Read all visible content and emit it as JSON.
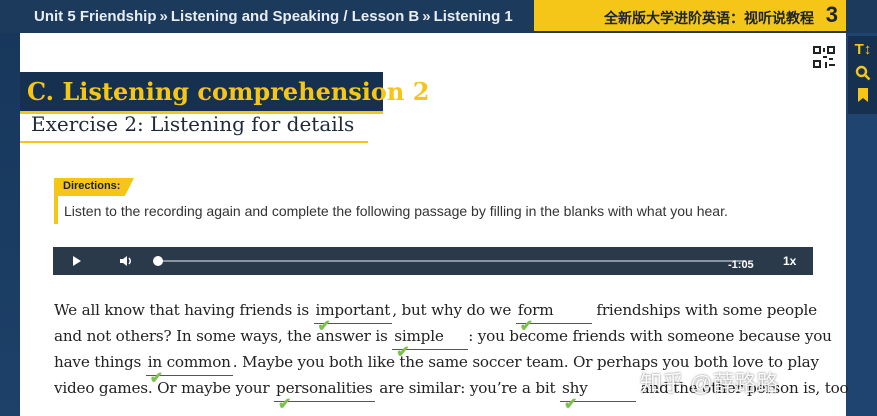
{
  "header": {
    "breadcrumb": [
      "Unit 5 Friendship",
      "Listening and Speaking / Lesson B",
      "Listening 1"
    ],
    "breadcrumb_separator": "»",
    "brand": "全新版大学进阶英语：视听说教程",
    "brand_number": "3",
    "accent_color": "#f5c518",
    "dark_color": "#16314f"
  },
  "section": {
    "title": "C. Listening comprehension 2"
  },
  "exercise": {
    "title": "Exercise 2: Listening for details",
    "directions_label": "Directions:",
    "directions_text": "Listen to the recording again and complete the following passage by filling in the blanks with what you hear."
  },
  "player": {
    "time": "-1:05",
    "speed": "1x",
    "progress": 0
  },
  "rail": {
    "icons": [
      "font-size-icon",
      "search-icon",
      "bookmark-icon"
    ],
    "font_icon_text": "T↕"
  },
  "passage": {
    "l1_a": "We all know that having friends is ",
    "l1_b1": "important",
    "l1_c": ", but why do we ",
    "l1_b2": "form",
    "l1_d": " friendships with some people",
    "l2_a": "and not others? In some ways, the answer is ",
    "l2_b1": "simple",
    "l2_c": ": you become friends with someone because you",
    "l3_a": "have things ",
    "l3_b1": "in common",
    "l3_c": ". Maybe you both like the same soccer team. Or perhaps you both love to play",
    "l4_a": "video games. Or maybe your ",
    "l4_b1": "personalities",
    "l4_c": " are similar: you’re a bit ",
    "l4_b2": "shy",
    "l4_d": " and the other person is, too"
  },
  "watermark": "知乎 @薛路路"
}
